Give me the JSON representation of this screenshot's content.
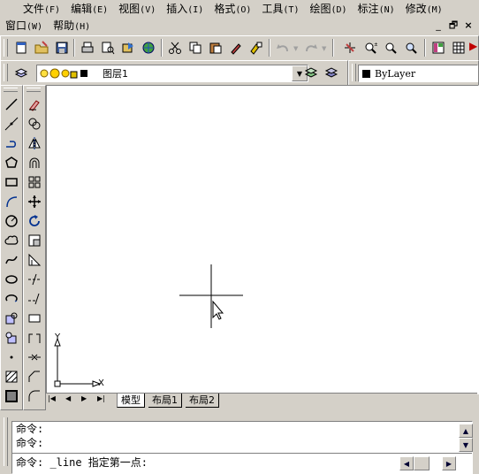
{
  "menu": {
    "row1": [
      {
        "label": "文件",
        "acc": "(F)"
      },
      {
        "label": "编辑",
        "acc": "(E)"
      },
      {
        "label": "视图",
        "acc": "(V)"
      },
      {
        "label": "插入",
        "acc": "(I)"
      },
      {
        "label": "格式",
        "acc": "(O)"
      },
      {
        "label": "工具",
        "acc": "(T)"
      },
      {
        "label": "绘图",
        "acc": "(D)"
      },
      {
        "label": "标注",
        "acc": "(N)"
      },
      {
        "label": "修改",
        "acc": "(M)"
      }
    ],
    "row2": [
      {
        "label": "窗口",
        "acc": "(W)"
      },
      {
        "label": "帮助",
        "acc": "(H)"
      }
    ]
  },
  "window_controls": {
    "minimize": "_",
    "restore": "🗗",
    "close": "×"
  },
  "layer": {
    "name": "图层1"
  },
  "linetype": {
    "value": "ByLayer"
  },
  "ucs": {
    "y_label": "Y",
    "x_label": "X"
  },
  "tabs": [
    "模型",
    "布局1",
    "布局2"
  ],
  "command": {
    "lines": [
      "命令:",
      "命令:"
    ],
    "prompt": "命令: _line 指定第一点:"
  },
  "colors": {
    "canvas": "#ffffff",
    "chrome": "#d4d0c8"
  }
}
